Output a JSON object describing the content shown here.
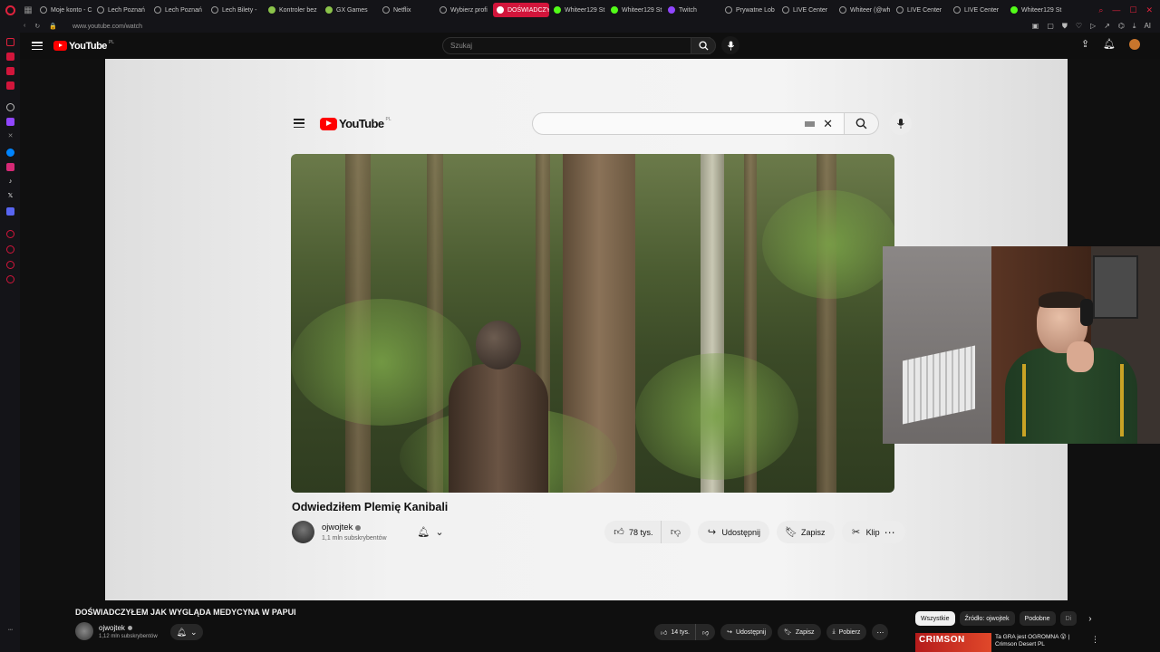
{
  "browser": {
    "tabs": [
      {
        "label": "Moje konto - C",
        "active": false
      },
      {
        "label": "Lech Poznań",
        "active": false
      },
      {
        "label": "Lech Poznań",
        "active": false
      },
      {
        "label": "Lech Bilety - ",
        "active": false
      },
      {
        "label": "Kontroler bez",
        "active": false
      },
      {
        "label": "GX Games",
        "active": false
      },
      {
        "label": "Netflix",
        "active": false
      },
      {
        "label": "Wybierz profi",
        "active": false
      },
      {
        "label": "DOŚWIADCZYŁEM J",
        "active": true
      },
      {
        "label": "Whiteer129 St",
        "active": false
      },
      {
        "label": "Whiteer129 St",
        "active": false
      },
      {
        "label": "Twitch",
        "active": false
      },
      {
        "label": "Prywatne Lob",
        "active": false
      },
      {
        "label": "LIVE Center",
        "active": false
      },
      {
        "label": "Whiteer (@wh",
        "active": false
      },
      {
        "label": "LIVE Center",
        "active": false
      },
      {
        "label": "LIVE Center",
        "active": false
      },
      {
        "label": "Whiteer129 St",
        "active": false
      }
    ],
    "url": "www.youtube.com/watch",
    "ai_label": "AI"
  },
  "outer_header": {
    "logo_text": "YouTube",
    "country_code": "PL",
    "search_placeholder": "Szukaj"
  },
  "inner_page": {
    "logo_text": "YouTube",
    "country_code": "PL",
    "video_title": "Odwiedziłem Plemię Kanibali",
    "channel_name": "ojwojtek",
    "subscribers": "1,1 mln subskrybentów",
    "likes": "78 tys.",
    "share_label": "Udostępnij",
    "save_label": "Zapisz",
    "clip_label": "Klip"
  },
  "bottom_bar": {
    "video_title": "DOŚWIADCZYŁEM JAK WYGLĄDA MEDYCYNA W PAPUI",
    "channel_name": "ojwojtek",
    "subscribers": "1,12 mln subskrybentów",
    "likes": "14 tys.",
    "share_label": "Udostępnij",
    "save_label": "Zapisz",
    "download_label": "Pobierz",
    "chips": [
      {
        "label": "Wszystkie",
        "selected": true
      },
      {
        "label": "Źródło: ojwojtek",
        "selected": false
      },
      {
        "label": "Podobne",
        "selected": false
      },
      {
        "label": "Di",
        "selected": false
      }
    ],
    "recommendation": {
      "thumb_text": "CRIMSON",
      "title": "Ta GRA jest OGROMNA 😮 |",
      "subtitle": "Crimson Desert PL"
    }
  },
  "colors": {
    "accent": "#d2153b",
    "yt_red": "#ff0000",
    "bg_dark": "#0f0f0f"
  }
}
